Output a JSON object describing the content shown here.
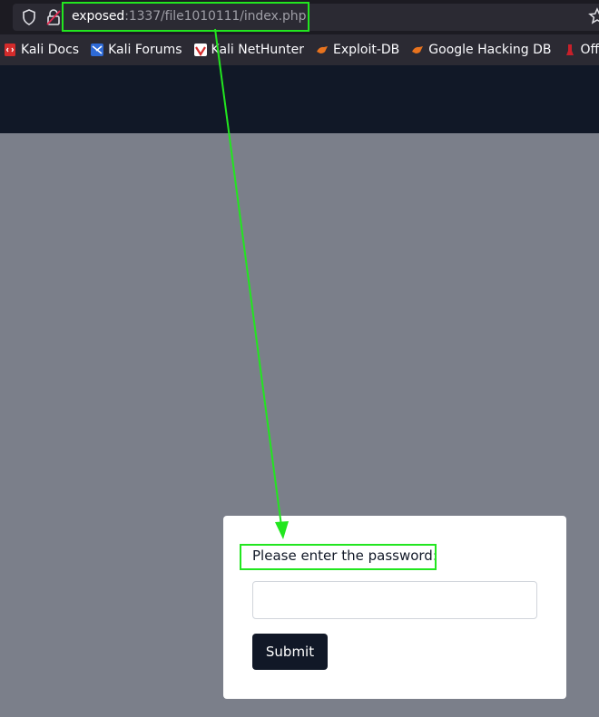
{
  "browser": {
    "url_host": "exposed",
    "url_rest": ":1337/file1010111/index.php",
    "bookmarks": [
      {
        "label": "Kali Docs",
        "icon": "kali-docs-icon",
        "color": "#d42b2b"
      },
      {
        "label": "Kali Forums",
        "icon": "kali-forums-icon",
        "color": "#2e6ad6"
      },
      {
        "label": "Kali NetHunter",
        "icon": "kali-nethunter-icon",
        "color": "#d42b2b"
      },
      {
        "label": "Exploit-DB",
        "icon": "exploit-db-icon",
        "color": "#e8731e"
      },
      {
        "label": "Google Hacking DB",
        "icon": "google-hacking-db-icon",
        "color": "#e8731e"
      },
      {
        "label": "OffSec",
        "icon": "offsec-icon",
        "color": "#c8202a"
      }
    ]
  },
  "form": {
    "prompt": "Please enter the password:",
    "password_value": "",
    "submit_label": "Submit"
  },
  "colors": {
    "header_bg": "#111827",
    "page_bg": "#7b7f8a",
    "annotation": "#22e61f"
  }
}
